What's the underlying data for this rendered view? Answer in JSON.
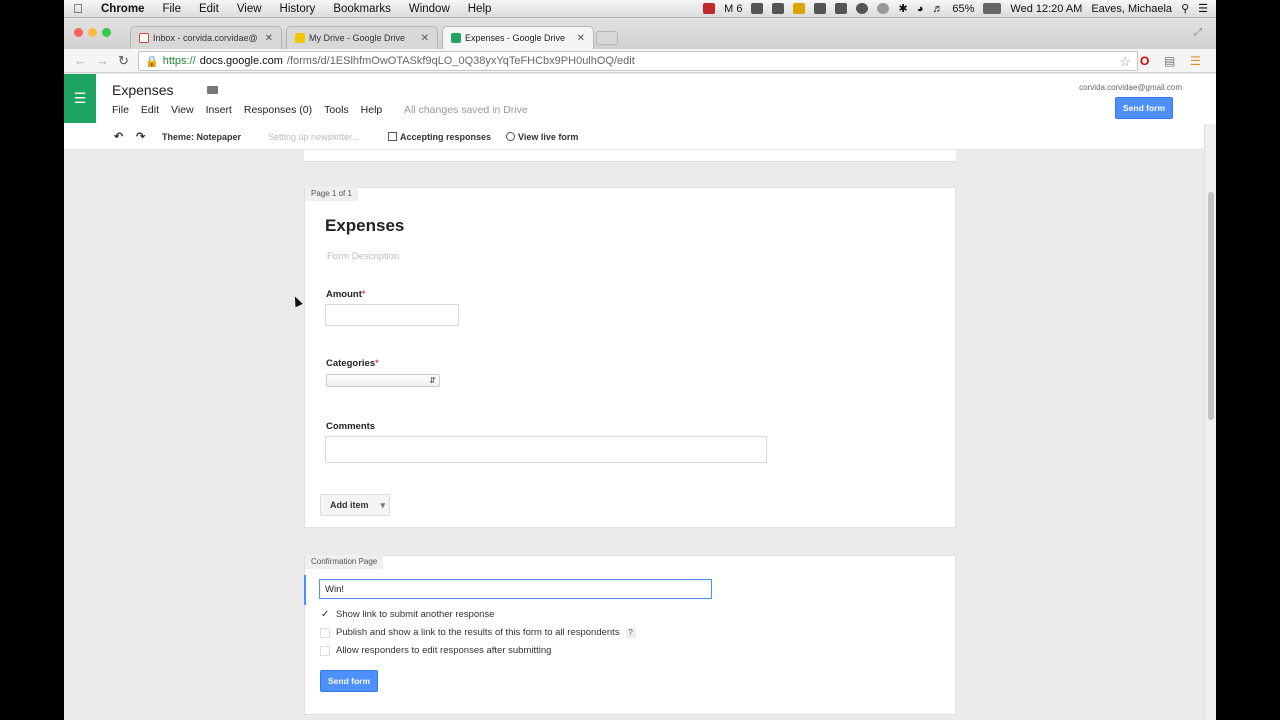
{
  "menubar": {
    "app": "Chrome",
    "items": [
      "File",
      "Edit",
      "View",
      "History",
      "Bookmarks",
      "Window",
      "Help"
    ],
    "gmail_count": "6",
    "battery": "65%",
    "clock": "Wed 12:20 AM",
    "user": "Eaves, Michaela"
  },
  "tabs": [
    {
      "label": "Inbox - corvida.corvidae@",
      "active": false
    },
    {
      "label": "My Drive - Google Drive",
      "active": false
    },
    {
      "label": "Expenses - Google Drive",
      "active": true
    }
  ],
  "address": {
    "scheme": "https://",
    "host": "docs.google.com",
    "path": "/forms/d/1ESlhfmOwOTASkf9qLO_0Q38yxYqTeFHCbx9PH0ulhOQ/edit"
  },
  "docs": {
    "title": "Expenses",
    "menus": [
      "File",
      "Edit",
      "View",
      "Insert",
      "Responses (0)",
      "Tools",
      "Help"
    ],
    "saved_status": "All changes saved in Drive",
    "account": "corvida.corvidae@gmail.com",
    "send_form": "Send form"
  },
  "form_toolbar": {
    "theme": "Theme: Notepaper",
    "setting_up": "Setting up newsletter...",
    "accepting": "Accepting responses",
    "view_live": "View live form"
  },
  "form": {
    "page_tag": "Page 1 of 1",
    "title": "Expenses",
    "description": "Form Description",
    "questions": [
      {
        "label": "Amount",
        "required": "*"
      },
      {
        "label": "Categories",
        "required": "*"
      },
      {
        "label": "Comments",
        "required": ""
      }
    ],
    "add_item": "Add item"
  },
  "confirmation": {
    "tag": "Confirmation Page",
    "message": "Win!",
    "options": [
      {
        "label": "Show link to submit another response",
        "checked": true
      },
      {
        "label": "Publish and show a link to the results of this form to all respondents",
        "checked": false
      },
      {
        "label": "Allow responders to edit responses after submitting",
        "checked": false
      }
    ],
    "help": "?",
    "send_form": "Send form"
  },
  "colors": {
    "forms_green": "#1fa463",
    "button_blue": "#4d90fe"
  }
}
